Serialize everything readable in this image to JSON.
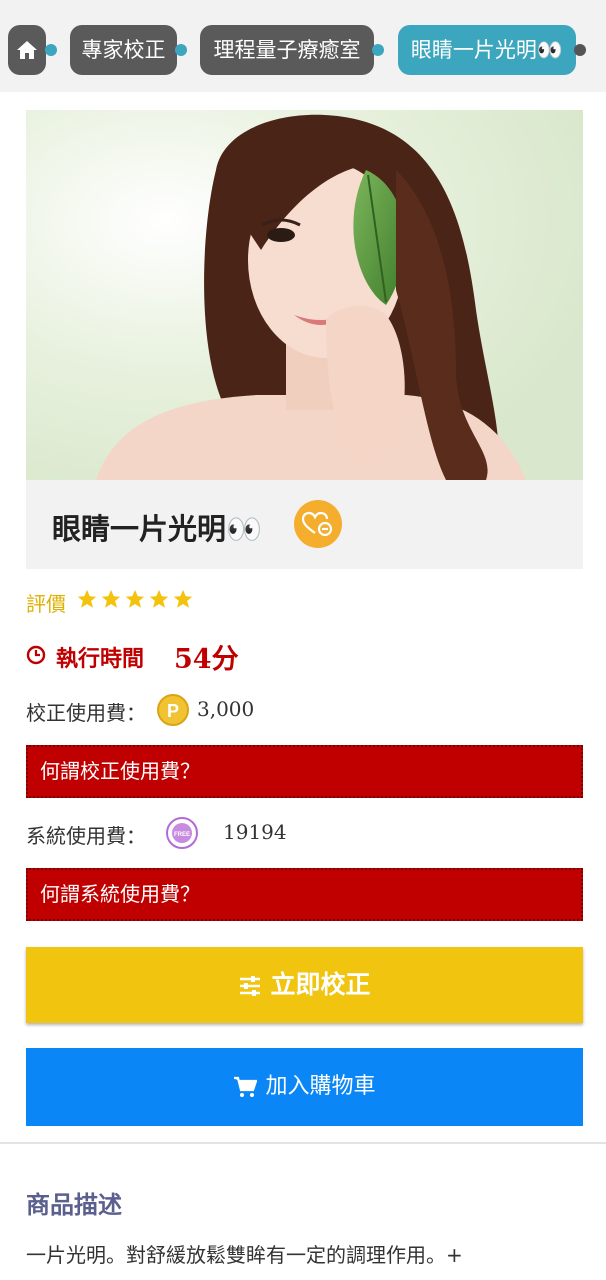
{
  "breadcrumb": {
    "home_icon": "home-icon",
    "items": [
      "專家校正",
      "理程量子療癒室",
      "眼睛一片光明👀"
    ]
  },
  "product": {
    "title": "眼睛一片光明👀",
    "favorite_icon": "heart-minus-icon",
    "rating_label": "評價",
    "rating_stars": 5,
    "exec_label": "執行時間",
    "exec_value": "54分",
    "calib_fee_label": "校正使用費：",
    "calib_fee_value": "3,000",
    "calib_fee_icon": "p-coin-icon",
    "calib_fee_help": "何謂校正使用費？",
    "system_fee_label": "系統使用費：",
    "system_fee_value": "19194",
    "system_fee_icon": "free-coin-icon",
    "system_fee_help": "何謂系統使用費？"
  },
  "actions": {
    "calibrate_label": "立即校正",
    "cart_label": "加入購物車"
  },
  "description": {
    "title": "商品描述",
    "text": "一片光明。對舒緩放鬆雙眸有一定的調理作用。+"
  },
  "colors": {
    "breadcrumb_bg": "#5a5a5a",
    "breadcrumb_active": "#3ba6bd",
    "help_red": "#c00000",
    "calibrate_yellow": "#f1c40f",
    "cart_blue": "#0a86f7",
    "desc_title": "#5b5f8e"
  }
}
